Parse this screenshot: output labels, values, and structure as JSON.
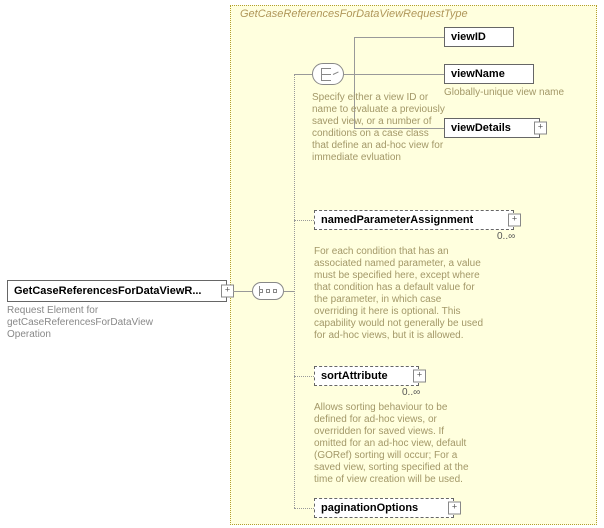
{
  "container": {
    "title": "GetCaseReferencesForDataViewRequestType"
  },
  "root": {
    "label": "GetCaseReferencesForDataViewR...",
    "note": "Request Element for getCaseReferencesForDataView Operation"
  },
  "choice": {
    "note": "Specify either a view ID or name to evaluate a previously saved view, or a number of conditions on a case class that define an ad-hoc view for immediate evluation",
    "options": {
      "viewID": {
        "label": "viewID"
      },
      "viewName": {
        "label": "viewName",
        "note": "Globally-unique view name"
      },
      "viewDetails": {
        "label": "viewDetails"
      }
    }
  },
  "namedParam": {
    "label": "namedParameterAssignment",
    "cardinality": "0..∞",
    "note": "For each condition that has an associated named parameter, a value must be specified here, except where that condition has a default value for the parameter, in which case overriding it here is optional. This capability would not generally be used for ad-hoc views, but it is allowed."
  },
  "sortAttr": {
    "label": "sortAttribute",
    "cardinality": "0..∞",
    "note": "Allows sorting behaviour to be defined for ad-hoc views, or overridden for saved views. If omitted for an ad-hoc view, default (GORef) sorting will occur; For a saved view, sorting specified at the time of view creation will be used."
  },
  "pagination": {
    "label": "paginationOptions"
  }
}
